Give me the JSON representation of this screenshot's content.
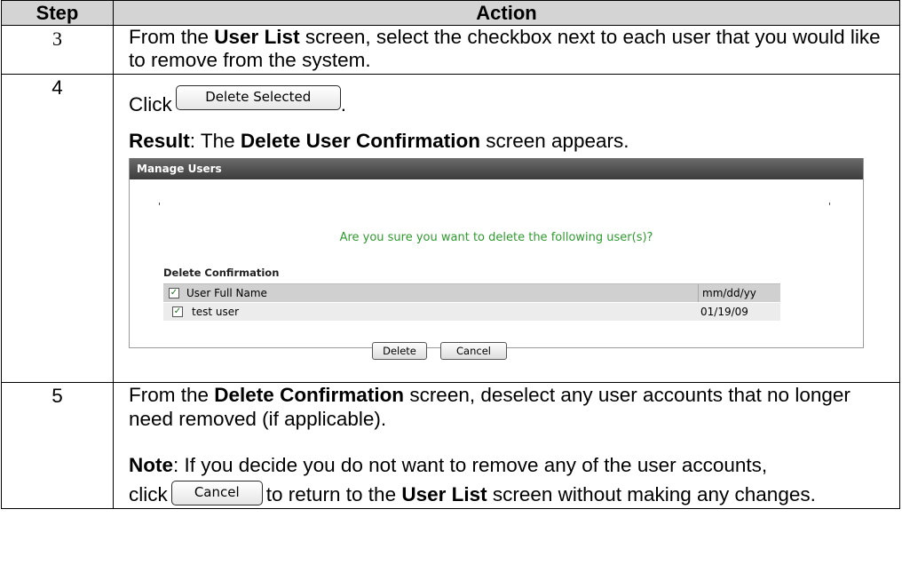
{
  "header": {
    "step": "Step",
    "action": "Action"
  },
  "rows": [
    {
      "step": "3",
      "text": {
        "pre": "From the ",
        "bold1": "User List",
        "post": " screen, select the checkbox next to each user that you would like to remove from the system."
      }
    },
    {
      "step": "4",
      "click_word": "Click",
      "button_label": "Delete Selected",
      "period": ".",
      "result": {
        "label": "Result",
        "pre": ":  The ",
        "bold": "Delete User Confirmation",
        "post": " screen appears."
      },
      "screenshot": {
        "title": "Manage Users",
        "tick_left": "'",
        "tick_right": "'",
        "question": "Are you sure you want to delete the following user(s)?",
        "section_label": "Delete Confirmation",
        "columns": {
          "name": "User Full Name",
          "date": "mm/dd/yy"
        },
        "users": [
          {
            "name": "test user",
            "date": "01/19/09",
            "checked": true
          }
        ],
        "header_checked": true,
        "delete_button": "Delete",
        "cancel_button": "Cancel"
      }
    },
    {
      "step": "5",
      "text": {
        "pre": "From the ",
        "bold1": "Delete Confirmation",
        "post": " screen, deselect any user accounts that no longer need removed (if applicable)."
      },
      "note": {
        "label": "Note",
        "pre": ":  If you decide you do not want to remove any of the user accounts,",
        "click_word": "click",
        "button_label": "Cancel",
        "mid": "to return to the ",
        "bold": "User List",
        "post": " screen without making any changes."
      }
    }
  ]
}
